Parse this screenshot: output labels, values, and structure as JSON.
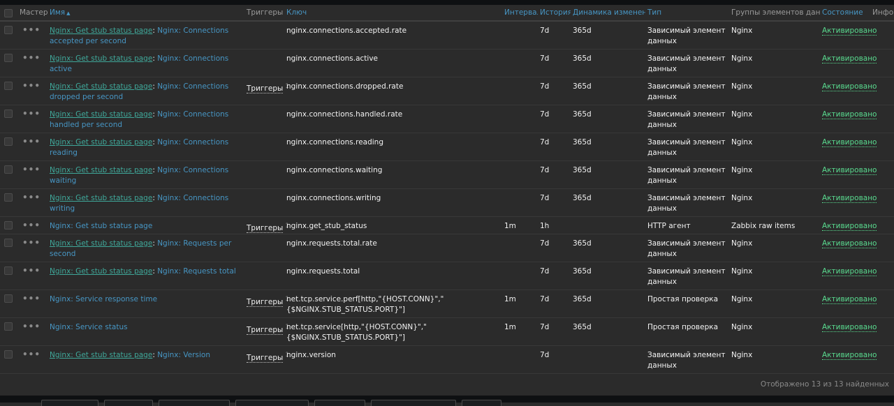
{
  "header": {
    "master": "Мастер",
    "name": "Имя",
    "triggers": "Триггеры",
    "key": "Ключ",
    "interval": "Интервал",
    "history": "История",
    "trends": "Динамика изменений",
    "type": "Тип",
    "groups": "Группы элементов данных",
    "status": "Состояние",
    "info": "Инфо",
    "sort_arrow": "▲"
  },
  "rows": [
    {
      "parent": "Nginx: Get stub status page",
      "sep": ": ",
      "name": "Nginx: Connections accepted per second",
      "triggers": "",
      "trig_count": "",
      "key": "nginx.connections.accepted.rate",
      "interval": "",
      "history": "7d",
      "trends": "365d",
      "type": "Зависимый элемент данных",
      "group": "Nginx",
      "status": "Активировано"
    },
    {
      "parent": "Nginx: Get stub status page",
      "sep": ": ",
      "name": "Nginx: Connections active",
      "triggers": "",
      "trig_count": "",
      "key": "nginx.connections.active",
      "interval": "",
      "history": "7d",
      "trends": "365d",
      "type": "Зависимый элемент данных",
      "group": "Nginx",
      "status": "Активировано"
    },
    {
      "parent": "Nginx: Get stub status page",
      "sep": ": ",
      "name": "Nginx: Connections dropped per second",
      "triggers": "Триггеры",
      "trig_count": "1",
      "key": "nginx.connections.dropped.rate",
      "interval": "",
      "history": "7d",
      "trends": "365d",
      "type": "Зависимый элемент данных",
      "group": "Nginx",
      "status": "Активировано"
    },
    {
      "parent": "Nginx: Get stub status page",
      "sep": ": ",
      "name": "Nginx: Connections handled per second",
      "triggers": "",
      "trig_count": "",
      "key": "nginx.connections.handled.rate",
      "interval": "",
      "history": "7d",
      "trends": "365d",
      "type": "Зависимый элемент данных",
      "group": "Nginx",
      "status": "Активировано"
    },
    {
      "parent": "Nginx: Get stub status page",
      "sep": ": ",
      "name": "Nginx: Connections reading",
      "triggers": "",
      "trig_count": "",
      "key": "nginx.connections.reading",
      "interval": "",
      "history": "7d",
      "trends": "365d",
      "type": "Зависимый элемент данных",
      "group": "Nginx",
      "status": "Активировано"
    },
    {
      "parent": "Nginx: Get stub status page",
      "sep": ": ",
      "name": "Nginx: Connections waiting",
      "triggers": "",
      "trig_count": "",
      "key": "nginx.connections.waiting",
      "interval": "",
      "history": "7d",
      "trends": "365d",
      "type": "Зависимый элемент данных",
      "group": "Nginx",
      "status": "Активировано"
    },
    {
      "parent": "Nginx: Get stub status page",
      "sep": ": ",
      "name": "Nginx: Connections writing",
      "triggers": "",
      "trig_count": "",
      "key": "nginx.connections.writing",
      "interval": "",
      "history": "7d",
      "trends": "365d",
      "type": "Зависимый элемент данных",
      "group": "Nginx",
      "status": "Активировано"
    },
    {
      "parent": "",
      "sep": "",
      "name": "Nginx: Get stub status page",
      "triggers": "Триггеры",
      "trig_count": "1",
      "key": "nginx.get_stub_status",
      "interval": "1m",
      "history": "1h",
      "trends": "",
      "type": "HTTP агент",
      "group": "Zabbix raw items",
      "status": "Активировано"
    },
    {
      "parent": "Nginx: Get stub status page",
      "sep": ": ",
      "name": "Nginx: Requests per second",
      "triggers": "",
      "trig_count": "",
      "key": "nginx.requests.total.rate",
      "interval": "",
      "history": "7d",
      "trends": "365d",
      "type": "Зависимый элемент данных",
      "group": "Nginx",
      "status": "Активировано"
    },
    {
      "parent": "Nginx: Get stub status page",
      "sep": ": ",
      "name": "Nginx: Requests total",
      "triggers": "",
      "trig_count": "",
      "key": "nginx.requests.total",
      "interval": "",
      "history": "7d",
      "trends": "365d",
      "type": "Зависимый элемент данных",
      "group": "Nginx",
      "status": "Активировано"
    },
    {
      "parent": "",
      "sep": "",
      "name": "Nginx: Service response time",
      "triggers": "Триггеры",
      "trig_count": "1",
      "key": "net.tcp.service.perf[http,\"{HOST.CONN}\",\"{$NGINX.STUB_STATUS.PORT}\"]",
      "interval": "1m",
      "history": "7d",
      "trends": "365d",
      "type": "Простая проверка",
      "group": "Nginx",
      "status": "Активировано"
    },
    {
      "parent": "",
      "sep": "",
      "name": "Nginx: Service status",
      "triggers": "Триггеры",
      "trig_count": "1",
      "key": "net.tcp.service[http,\"{HOST.CONN}\",\"{$NGINX.STUB_STATUS.PORT}\"]",
      "interval": "1m",
      "history": "7d",
      "trends": "365d",
      "type": "Простая проверка",
      "group": "Nginx",
      "status": "Активировано"
    },
    {
      "parent": "Nginx: Get stub status page",
      "sep": ": ",
      "name": "Nginx: Version",
      "triggers": "Триггеры",
      "trig_count": "1",
      "key": "nginx.version",
      "interval": "",
      "history": "7d",
      "trends": "",
      "type": "Зависимый элемент данных",
      "group": "Nginx",
      "status": "Активировано"
    }
  ],
  "footer": "Отображено 13 из 13 найденных",
  "icons": {
    "more": "more-dots-icon",
    "sort": "sort-asc-icon"
  }
}
